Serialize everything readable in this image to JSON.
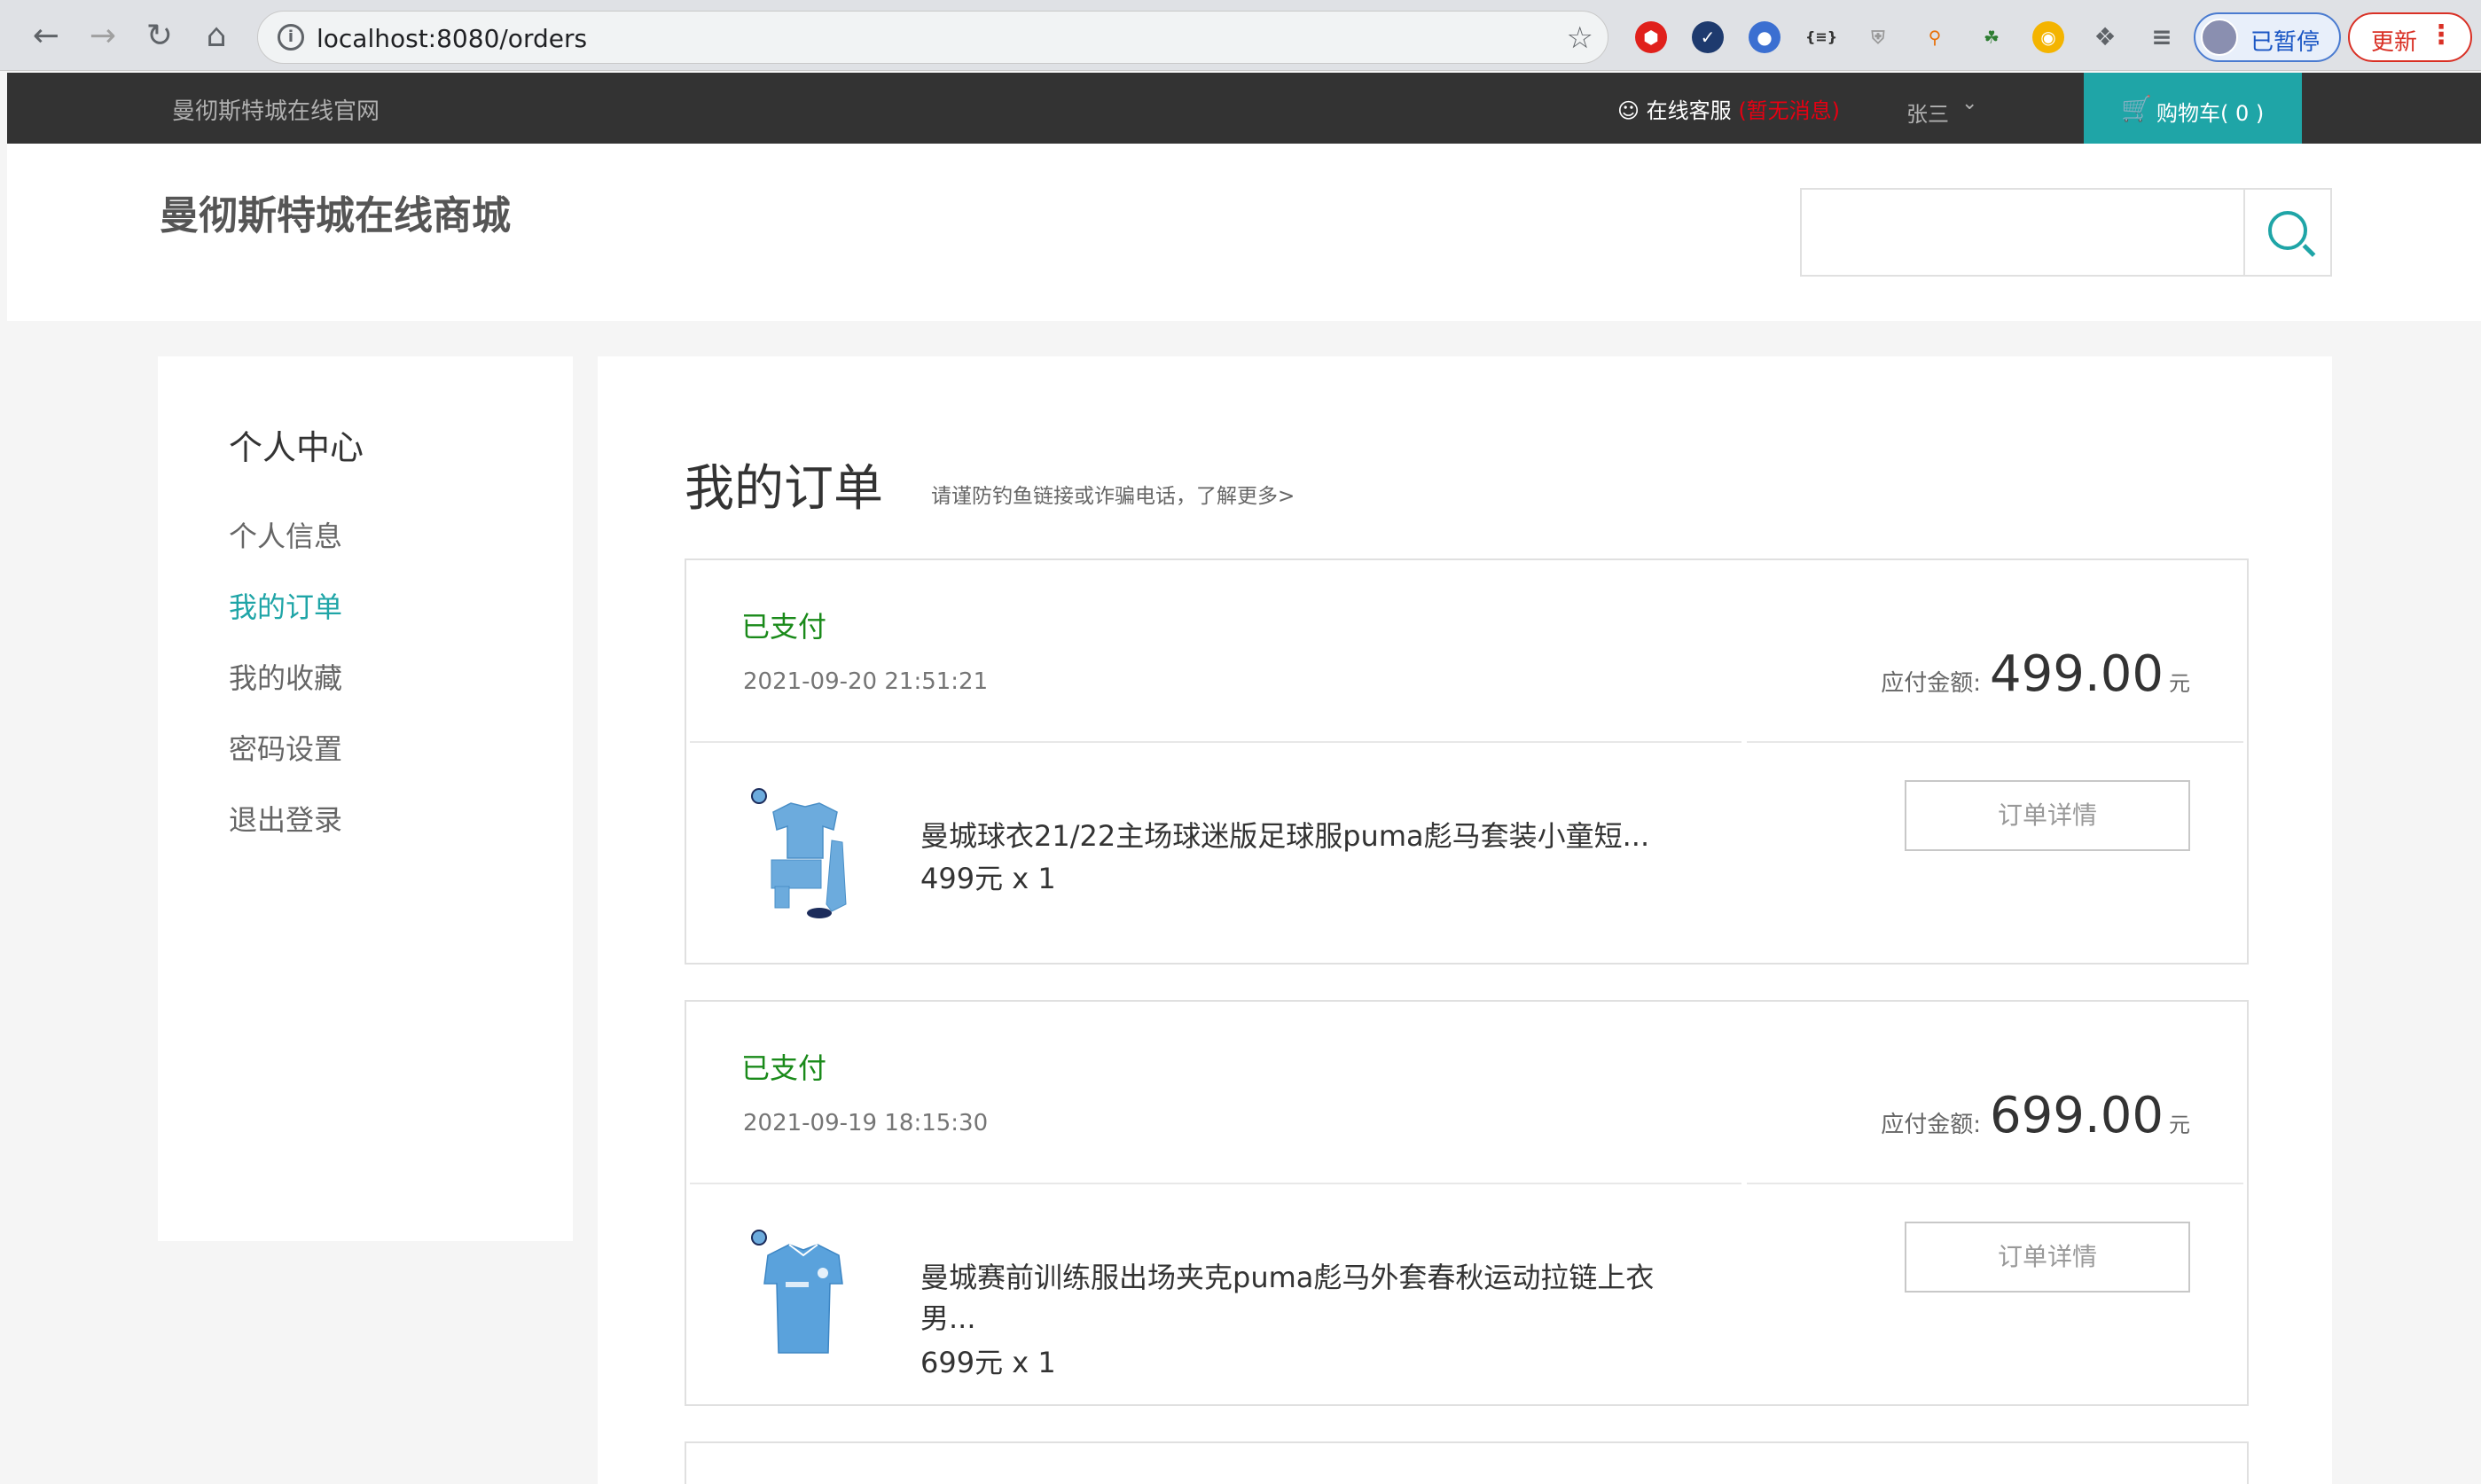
{
  "browser": {
    "url": "localhost:8080/orders",
    "paused_label": "已暂停",
    "update_label": "更新"
  },
  "topbar": {
    "site_name": "曼彻斯特城在线官网",
    "service_label": "在线客服",
    "service_msg": "(暂无消息)",
    "user_name": "张三",
    "cart_label": "购物车( 0 )"
  },
  "header": {
    "title": "曼彻斯特城在线商城",
    "search_placeholder": ""
  },
  "sidebar": {
    "heading": "个人中心",
    "items": [
      {
        "label": "个人信息",
        "active": false
      },
      {
        "label": "我的订单",
        "active": true
      },
      {
        "label": "我的收藏",
        "active": false
      },
      {
        "label": "密码设置",
        "active": false
      },
      {
        "label": "退出登录",
        "active": false
      }
    ]
  },
  "main": {
    "title": "我的订单",
    "tip": "请谨防钓鱼链接或诈骗电话，了解更多>",
    "orders": [
      {
        "status": "已支付",
        "time": "2021-09-20 21:51:21",
        "pay_label": "应付金额:",
        "amount": "499.00",
        "unit": "元",
        "product_name": "曼城球衣21/22主场球迷版足球服puma彪马套装小童短...",
        "product_price": "499元 x 1",
        "detail_label": "订单详情"
      },
      {
        "status": "已支付",
        "time": "2021-09-19 18:15:30",
        "pay_label": "应付金额:",
        "amount": "699.00",
        "unit": "元",
        "product_name": "曼城赛前训练服出场夹克puma彪马外套春秋运动拉链上衣男...",
        "product_price": "699元 x 1",
        "detail_label": "订单详情"
      }
    ]
  },
  "colors": {
    "accent": "#1fa5a7",
    "paid": "#1a8a1a",
    "topbar": "#333333"
  }
}
